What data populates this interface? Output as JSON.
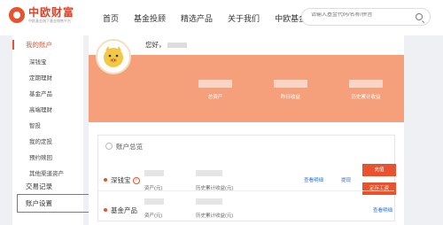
{
  "brand": {
    "name": "中欧财富",
    "tagline": "中欧基金旗下基金销售平台"
  },
  "nav": [
    "首页",
    "基金投顾",
    "精选产品",
    "关于我们",
    "中欧基金"
  ],
  "search": {
    "placeholder": "请输入基金代码/名称/拼音"
  },
  "sidebar": {
    "my_account": "我的账户",
    "sub_items": [
      "深钱宝",
      "定期理财",
      "基金产品",
      "高端理财",
      "智投",
      "我的定投",
      "预约赎回",
      "其他渠道资产"
    ],
    "transactions": "交易记录",
    "settings": "账户设置"
  },
  "user": {
    "greeting": "您好，"
  },
  "stats": [
    "总资产",
    "昨日收益",
    "历史累计收益"
  ],
  "overview": {
    "title": "账户总览",
    "rows": [
      {
        "name": "深钱宝",
        "labels": [
          "资产(元)",
          "历史累计收益(元)"
        ],
        "links": [
          "查看明细",
          "提现"
        ],
        "buttons": [
          "充值",
          "定存工资"
        ]
      },
      {
        "name": "基金产品",
        "labels": [
          "资产(元)",
          "历史累计收益(元)"
        ],
        "links": [
          "查看明细"
        ]
      }
    ]
  },
  "colors": {
    "accent": "#e8522e",
    "banner": "#f5a07a",
    "link": "#2e6fc9"
  }
}
